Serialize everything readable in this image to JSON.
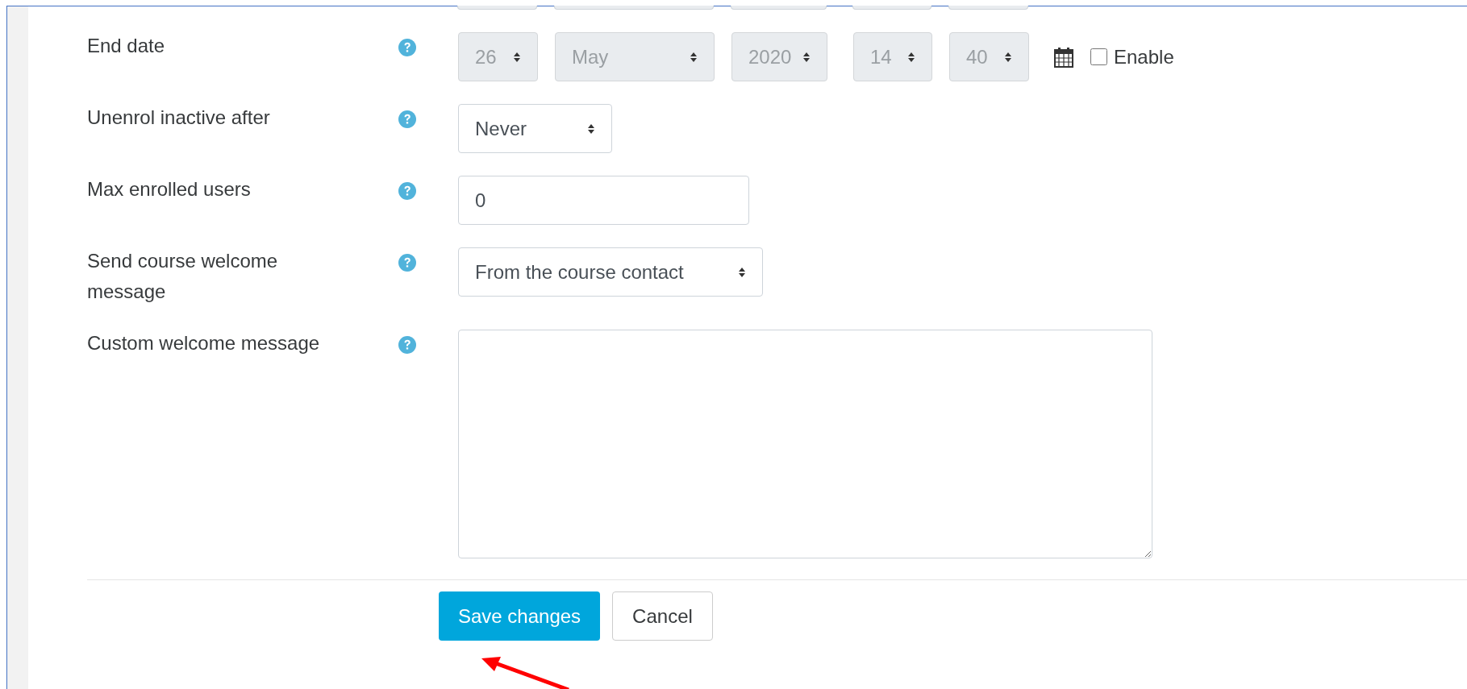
{
  "fields": [
    {
      "kind": "date",
      "label": "End date",
      "disabled": true,
      "parts": [
        {
          "value": "26"
        },
        {
          "value": "May"
        },
        {
          "value": "2020"
        },
        {
          "value": "14"
        },
        {
          "value": "40"
        }
      ],
      "enable": {
        "label": "Enable",
        "checked": false
      }
    },
    {
      "kind": "select",
      "label": "Unenrol inactive after",
      "value": "Never"
    },
    {
      "kind": "text",
      "label": "Max enrolled users",
      "value": "0"
    },
    {
      "kind": "select",
      "label": "Send course welcome message",
      "value": "From the course contact"
    },
    {
      "kind": "textarea",
      "label": "Custom welcome message"
    }
  ],
  "buttons": [
    {
      "label": "Save changes",
      "primary": true
    },
    {
      "label": "Cancel",
      "primary": false
    }
  ]
}
